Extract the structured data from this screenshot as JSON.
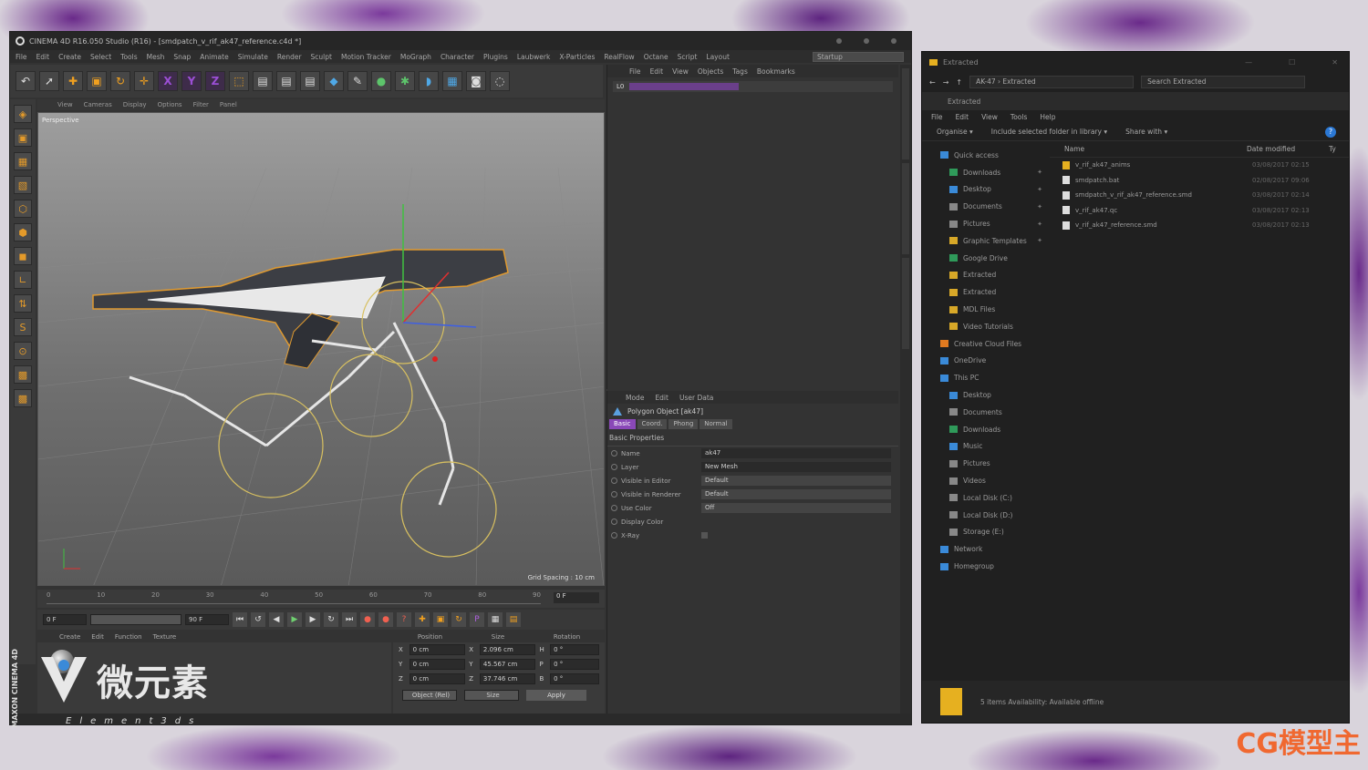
{
  "c4d": {
    "title": "CINEMA 4D R16.050 Studio (R16) - [smdpatch_v_rif_ak47_reference.c4d *]",
    "menu": [
      "File",
      "Edit",
      "Create",
      "Select",
      "Tools",
      "Mesh",
      "Snap",
      "Animate",
      "Simulate",
      "Render",
      "Sculpt",
      "Motion Tracker",
      "MoGraph",
      "Character",
      "Plugins",
      "Laubwerk",
      "X-Particles",
      "RealFlow",
      "Octane",
      "Script",
      "Layout"
    ],
    "layout_value": "Startup",
    "viewport_menu": [
      "View",
      "Cameras",
      "Display",
      "Options",
      "Filter",
      "Panel"
    ],
    "viewport_label": "Perspective",
    "grid_spacing": "Grid Spacing : 10 cm",
    "timeline_ticks": [
      "0",
      "10",
      "20",
      "30",
      "40",
      "50",
      "60",
      "70",
      "80",
      "90"
    ],
    "timeline_current": "0 F",
    "transport": {
      "start": "0 F",
      "end": "90 F"
    },
    "mat_menu": [
      "Create",
      "Edit",
      "Function",
      "Texture"
    ],
    "coord": {
      "headers": [
        "Position",
        "Size",
        "Rotation"
      ],
      "rows": [
        {
          "axis": "X",
          "pos": "0 cm",
          "size_axis": "X",
          "size": "2.096 cm",
          "rot_axis": "H",
          "rot": "0 °"
        },
        {
          "axis": "Y",
          "pos": "0 cm",
          "size_axis": "Y",
          "size": "45.567 cm",
          "rot_axis": "P",
          "rot": "0 °"
        },
        {
          "axis": "Z",
          "pos": "0 cm",
          "size_axis": "Z",
          "size": "37.746 cm",
          "rot_axis": "B",
          "rot": "0 °"
        }
      ],
      "mode": "Object (Rel)",
      "size_mode": "Size",
      "apply": "Apply"
    },
    "obj_menu": [
      "File",
      "Edit",
      "View",
      "Objects",
      "Tags",
      "Bookmarks"
    ],
    "obj_row": "L0",
    "attr_menu": [
      "Mode",
      "Edit",
      "User Data"
    ],
    "attr_object": "Polygon Object [ak47]",
    "attr_tabs": [
      "Basic",
      "Coord.",
      "Phong",
      "Normal"
    ],
    "attr_section": "Basic Properties",
    "attr_props": [
      {
        "label": "Name",
        "value": "ak47"
      },
      {
        "label": "Layer",
        "value": "New Mesh"
      },
      {
        "label": "Visible in Editor",
        "value": "Default"
      },
      {
        "label": "Visible in Renderer",
        "value": "Default"
      },
      {
        "label": "Use Color",
        "value": "Off"
      },
      {
        "label": "Display Color",
        "value": ""
      },
      {
        "label": "X-Ray",
        "value": ""
      }
    ],
    "maxon_label": "MAXON CINEMA 4D"
  },
  "logo": {
    "cn": "微元素",
    "sub": "Element3ds"
  },
  "explorer": {
    "title": "Extracted",
    "breadcrumb": "AK-47 › Extracted",
    "search_placeholder": "Search Extracted",
    "ribbon_label": "Extracted",
    "menu": [
      "File",
      "Edit",
      "View",
      "Tools",
      "Help"
    ],
    "commands": [
      "Organise ▾",
      "Include selected folder in library ▾",
      "Share with ▾"
    ],
    "nav": [
      {
        "label": "Quick access",
        "icon": "bl"
      },
      {
        "label": "Downloads",
        "icon": "gr"
      },
      {
        "label": "Desktop",
        "icon": "bl"
      },
      {
        "label": "Documents",
        "icon": "gy"
      },
      {
        "label": "Pictures",
        "icon": "gy"
      },
      {
        "label": "Graphic Templates",
        "icon": ""
      },
      {
        "label": "Google Drive",
        "icon": "gr"
      },
      {
        "label": "Extracted",
        "icon": ""
      },
      {
        "label": "Extracted",
        "icon": ""
      },
      {
        "label": "MDL Files",
        "icon": ""
      },
      {
        "label": "Video Tutorials",
        "icon": ""
      },
      {
        "label": "Creative Cloud Files",
        "icon": "or"
      },
      {
        "label": "OneDrive",
        "icon": "bl"
      },
      {
        "label": "This PC",
        "icon": "bl"
      },
      {
        "label": "Desktop",
        "icon": "bl"
      },
      {
        "label": "Documents",
        "icon": "gy"
      },
      {
        "label": "Downloads",
        "icon": "gr"
      },
      {
        "label": "Music",
        "icon": "bl"
      },
      {
        "label": "Pictures",
        "icon": "gy"
      },
      {
        "label": "Videos",
        "icon": "gy"
      },
      {
        "label": "Local Disk (C:)",
        "icon": "gy"
      },
      {
        "label": "Local Disk (D:)",
        "icon": "gy"
      },
      {
        "label": "Storage (E:)",
        "icon": "gy"
      },
      {
        "label": "Network",
        "icon": "bl"
      },
      {
        "label": "Homegroup",
        "icon": "bl"
      }
    ],
    "columns": [
      "Name",
      "Date modified",
      "Ty"
    ],
    "files": [
      {
        "name": "v_rif_ak47_anims",
        "date": "03/08/2017 02:15",
        "folder": true
      },
      {
        "name": "smdpatch.bat",
        "date": "02/08/2017 09:06",
        "folder": false
      },
      {
        "name": "smdpatch_v_rif_ak47_reference.smd",
        "date": "03/08/2017 02:14",
        "folder": false
      },
      {
        "name": "v_rif_ak47.qc",
        "date": "03/08/2017 02:13",
        "folder": false
      },
      {
        "name": "v_rif_ak47_reference.smd",
        "date": "03/08/2017 02:13",
        "folder": false
      }
    ],
    "status": "5 items  Availability:   Available offline"
  },
  "watermark": "CG模型主"
}
